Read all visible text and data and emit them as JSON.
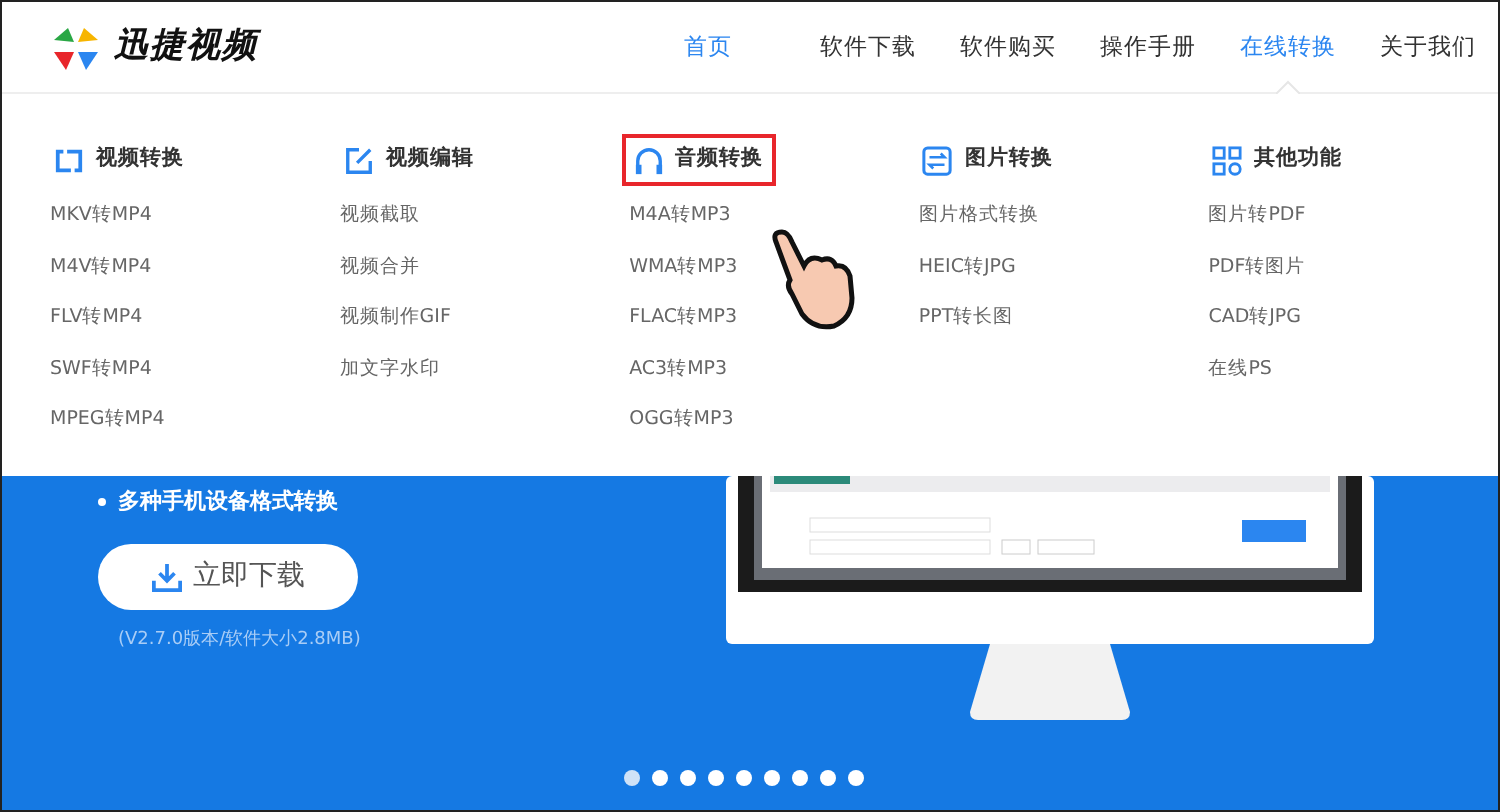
{
  "header": {
    "logo_text": "迅捷视频",
    "nav": [
      {
        "label": "首页",
        "selected": true,
        "open": false
      },
      {
        "label": "软件下载",
        "selected": false,
        "open": false
      },
      {
        "label": "软件购买",
        "selected": false,
        "open": false
      },
      {
        "label": "操作手册",
        "selected": false,
        "open": false
      },
      {
        "label": "在线转换",
        "selected": true,
        "open": true
      },
      {
        "label": "关于我们",
        "selected": false,
        "open": false
      }
    ]
  },
  "dropdown": {
    "categories": [
      {
        "kind": "convert",
        "title": "视频转换",
        "highlighted": false,
        "items": [
          "MKV转MP4",
          "M4V转MP4",
          "FLV转MP4",
          "SWF转MP4",
          "MPEG转MP4"
        ]
      },
      {
        "kind": "edit",
        "title": "视频编辑",
        "highlighted": false,
        "items": [
          "视频截取",
          "视频合并",
          "视频制作GIF",
          "加文字水印"
        ]
      },
      {
        "kind": "audio",
        "title": "音频转换",
        "highlighted": true,
        "items": [
          "M4A转MP3",
          "WMA转MP3",
          "FLAC转MP3",
          "AC3转MP3",
          "OGG转MP3"
        ]
      },
      {
        "kind": "image",
        "title": "图片转换",
        "highlighted": false,
        "items": [
          "图片格式转换",
          "HEIC转JPG",
          "PPT转长图"
        ]
      },
      {
        "kind": "tools",
        "title": "其他功能",
        "highlighted": false,
        "items": [
          "图片转PDF",
          "PDF转图片",
          "CAD转JPG",
          "在线PS"
        ]
      }
    ]
  },
  "hero": {
    "bullet": "多种手机设备格式转换",
    "download_button": "立即下载",
    "version_note": "(V2.7.0版本/软件大小2.8MB)",
    "carousel_dots": [
      {
        "selected": true
      },
      {
        "selected": false
      },
      {
        "selected": false
      },
      {
        "selected": false
      },
      {
        "selected": false
      },
      {
        "selected": false
      },
      {
        "selected": false
      },
      {
        "selected": false
      },
      {
        "selected": false
      }
    ]
  }
}
